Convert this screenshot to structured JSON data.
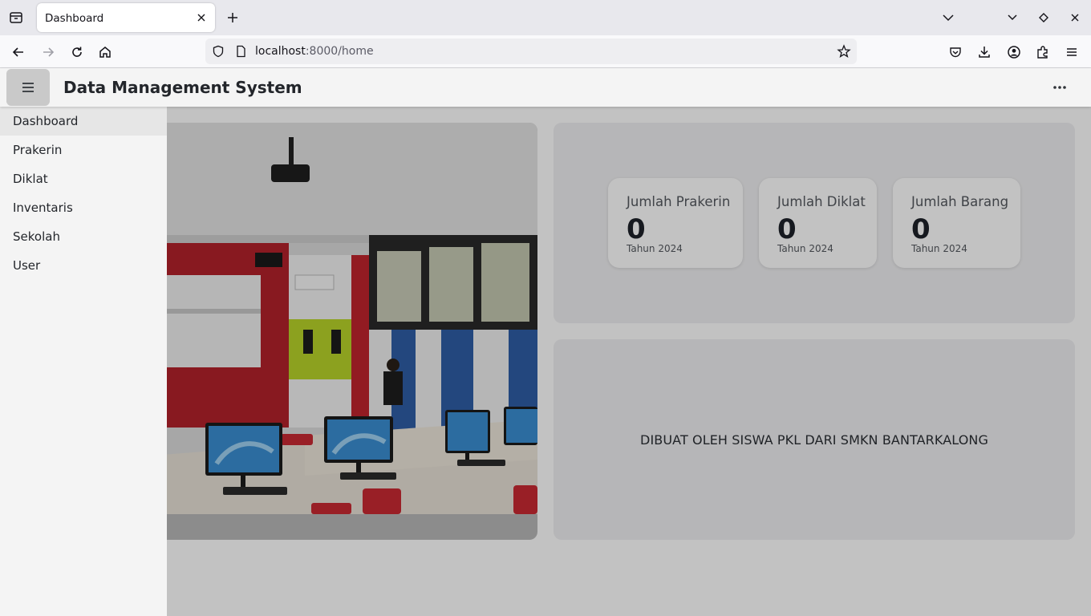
{
  "browser": {
    "tab_title": "Dashboard",
    "url_host": "localhost",
    "url_path": ":8000/home"
  },
  "app": {
    "title": "Data Management System"
  },
  "sidebar": {
    "items": [
      {
        "label": "Dashboard",
        "active": true
      },
      {
        "label": "Prakerin"
      },
      {
        "label": "Diklat"
      },
      {
        "label": "Inventaris"
      },
      {
        "label": "Sekolah"
      },
      {
        "label": "User"
      }
    ]
  },
  "stats": [
    {
      "label": "Jumlah Prakerin",
      "value": "0",
      "sub": "Tahun 2024"
    },
    {
      "label": "Jumlah Diklat",
      "value": "0",
      "sub": "Tahun 2024"
    },
    {
      "label": "Jumlah Barang",
      "value": "0",
      "sub": "Tahun 2024"
    }
  ],
  "credit": "DIBUAT OLEH SISWA PKL DARI SMKN BANTARKALONG",
  "colors": {
    "overlay": "#000000",
    "sidebar_bg": "#f4f4f4",
    "menu_button_bg": "#c9c9c9",
    "card_bg": "#f0f0f2"
  }
}
